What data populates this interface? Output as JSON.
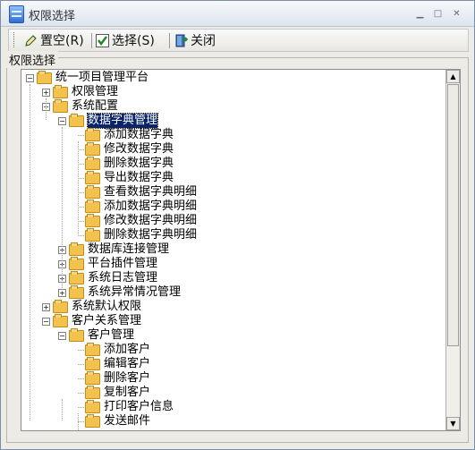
{
  "window": {
    "title": "权限选择",
    "controls": [
      "minimize-icon",
      "restore-icon",
      "close-icon"
    ]
  },
  "toolbar": {
    "clear_label": "置空(R)",
    "select_label": "选择(S)",
    "close_label": "关闭",
    "icons": {
      "clear": "pencil-icon",
      "select": "checkmark-icon",
      "close": "exit-icon"
    }
  },
  "group": {
    "label": "权限选择"
  },
  "tree": {
    "items": [
      {
        "label": "统一项目管理平台",
        "level": 0,
        "expander": "minus"
      },
      {
        "label": "权限管理",
        "level": 1,
        "expander": "plus"
      },
      {
        "label": "系统配置",
        "level": 1,
        "expander": "minus"
      },
      {
        "label": "数据字典管理",
        "level": 2,
        "expander": "minus",
        "selected": true
      },
      {
        "label": "添加数据字典",
        "level": 3
      },
      {
        "label": "修改数据字典",
        "level": 3
      },
      {
        "label": "删除数据字典",
        "level": 3
      },
      {
        "label": "导出数据字典",
        "level": 3
      },
      {
        "label": "查看数据字典明细",
        "level": 3
      },
      {
        "label": "添加数据字典明细",
        "level": 3
      },
      {
        "label": "修改数据字典明细",
        "level": 3
      },
      {
        "label": "删除数据字典明细",
        "level": 3
      },
      {
        "label": "数据库连接管理",
        "level": 2,
        "expander": "plus"
      },
      {
        "label": "平台插件管理",
        "level": 2,
        "expander": "plus"
      },
      {
        "label": "系统日志管理",
        "level": 2,
        "expander": "plus"
      },
      {
        "label": "系统异常情况管理",
        "level": 2,
        "expander": "plus"
      },
      {
        "label": "系统默认权限",
        "level": 1,
        "expander": "plus"
      },
      {
        "label": "客户关系管理",
        "level": 1,
        "expander": "minus"
      },
      {
        "label": "客户管理",
        "level": 2,
        "expander": "minus"
      },
      {
        "label": "添加客户",
        "level": 3
      },
      {
        "label": "编辑客户",
        "level": 3
      },
      {
        "label": "删除客户",
        "level": 3
      },
      {
        "label": "复制客户",
        "level": 3
      },
      {
        "label": "打印客户信息",
        "level": 3
      },
      {
        "label": "发送邮件",
        "level": 3
      }
    ]
  }
}
